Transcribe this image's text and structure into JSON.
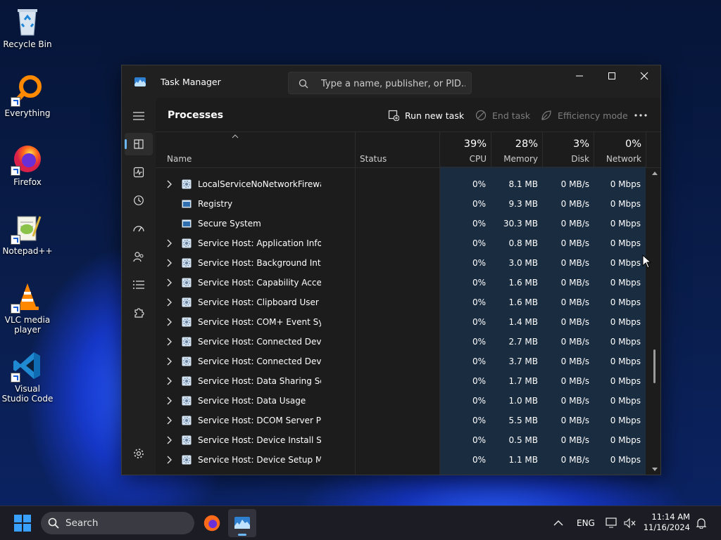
{
  "desktop": {
    "icons": [
      {
        "label": "Recycle Bin"
      },
      {
        "label": "Everything"
      },
      {
        "label": "Firefox"
      },
      {
        "label": "Notepad++"
      },
      {
        "label": "VLC media player"
      },
      {
        "label": "Visual Studio Code"
      }
    ]
  },
  "window": {
    "title": "Task Manager",
    "search_placeholder": "Type a name, publisher, or PID..."
  },
  "toolbar": {
    "page_title": "Processes",
    "run_new_task": "Run new task",
    "end_task": "End task",
    "efficiency_mode": "Efficiency mode"
  },
  "columns": {
    "name": "Name",
    "status": "Status",
    "cpu": {
      "pct": "39%",
      "label": "CPU"
    },
    "memory": {
      "pct": "28%",
      "label": "Memory"
    },
    "disk": {
      "pct": "3%",
      "label": "Disk"
    },
    "network": {
      "pct": "0%",
      "label": "Network"
    }
  },
  "processes": [
    {
      "name": "LocalServiceNoNetworkFirewa...",
      "expandable": true,
      "icon": "gear",
      "cpu": "0%",
      "memory": "8.1 MB",
      "disk": "0 MB/s",
      "network": "0 Mbps"
    },
    {
      "name": "Registry",
      "expandable": false,
      "icon": "window",
      "cpu": "0%",
      "memory": "9.3 MB",
      "disk": "0 MB/s",
      "network": "0 Mbps"
    },
    {
      "name": "Secure System",
      "expandable": false,
      "icon": "window",
      "cpu": "0%",
      "memory": "30.3 MB",
      "disk": "0 MB/s",
      "network": "0 Mbps"
    },
    {
      "name": "Service Host: Application Infor...",
      "expandable": true,
      "icon": "gear",
      "cpu": "0%",
      "memory": "0.8 MB",
      "disk": "0 MB/s",
      "network": "0 Mbps"
    },
    {
      "name": "Service Host: Background Inte...",
      "expandable": true,
      "icon": "gear",
      "cpu": "0%",
      "memory": "3.0 MB",
      "disk": "0 MB/s",
      "network": "0 Mbps"
    },
    {
      "name": "Service Host: Capability Acces...",
      "expandable": true,
      "icon": "gear",
      "cpu": "0%",
      "memory": "1.6 MB",
      "disk": "0 MB/s",
      "network": "0 Mbps"
    },
    {
      "name": "Service Host: Clipboard User S...",
      "expandable": true,
      "icon": "gear",
      "cpu": "0%",
      "memory": "1.6 MB",
      "disk": "0 MB/s",
      "network": "0 Mbps"
    },
    {
      "name": "Service Host: COM+ Event Sys...",
      "expandable": true,
      "icon": "gear",
      "cpu": "0%",
      "memory": "1.4 MB",
      "disk": "0 MB/s",
      "network": "0 Mbps"
    },
    {
      "name": "Service Host: Connected Devi...",
      "expandable": true,
      "icon": "gear",
      "cpu": "0%",
      "memory": "2.7 MB",
      "disk": "0 MB/s",
      "network": "0 Mbps"
    },
    {
      "name": "Service Host: Connected Devi...",
      "expandable": true,
      "icon": "gear",
      "cpu": "0%",
      "memory": "3.7 MB",
      "disk": "0 MB/s",
      "network": "0 Mbps"
    },
    {
      "name": "Service Host: Data Sharing Ser...",
      "expandable": true,
      "icon": "gear",
      "cpu": "0%",
      "memory": "1.7 MB",
      "disk": "0 MB/s",
      "network": "0 Mbps"
    },
    {
      "name": "Service Host: Data Usage",
      "expandable": true,
      "icon": "gear",
      "cpu": "0%",
      "memory": "1.0 MB",
      "disk": "0 MB/s",
      "network": "0 Mbps"
    },
    {
      "name": "Service Host: DCOM Server Pr...",
      "expandable": true,
      "icon": "gear",
      "cpu": "0%",
      "memory": "5.5 MB",
      "disk": "0 MB/s",
      "network": "0 Mbps"
    },
    {
      "name": "Service Host: Device Install Ser...",
      "expandable": true,
      "icon": "gear",
      "cpu": "0%",
      "memory": "0.5 MB",
      "disk": "0 MB/s",
      "network": "0 Mbps"
    },
    {
      "name": "Service Host: Device Setup Ma...",
      "expandable": true,
      "icon": "gear",
      "cpu": "0%",
      "memory": "1.1 MB",
      "disk": "0 MB/s",
      "network": "0 Mbps"
    }
  ],
  "taskbar": {
    "search_label": "Search",
    "language": "ENG",
    "time": "11:14 AM",
    "date": "11/16/2024"
  },
  "colors": {
    "accent": "#6cb8ff",
    "window_bg": "#202020",
    "highlight_column": "#1a2c40"
  }
}
